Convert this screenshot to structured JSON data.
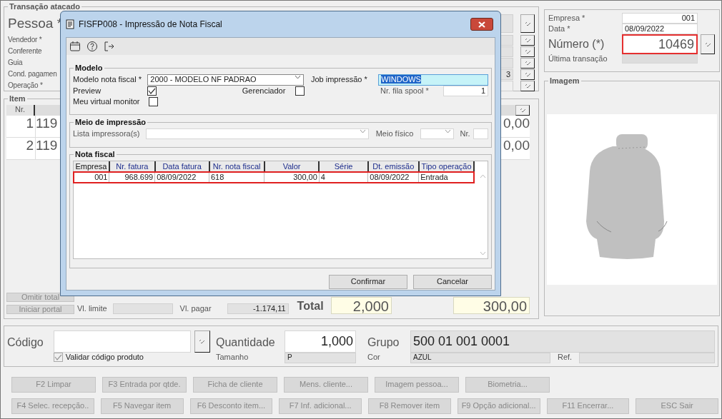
{
  "form": {
    "transaction": {
      "title": "Transação atacado",
      "person": {
        "label": "Pessoa *"
      },
      "fields": [
        {
          "label": "Vendedor *",
          "kind": "lookup"
        },
        {
          "label": "Conferente",
          "kind": "lookup"
        },
        {
          "label": "Guia",
          "kind": "lookup"
        },
        {
          "label": "Cond. pagamen",
          "kind": "lookup",
          "value": "3"
        },
        {
          "label": "Operação *",
          "kind": "dropdown"
        }
      ]
    },
    "items": {
      "title": "Item",
      "columns": [
        "Nr."
      ],
      "rows": [
        {
          "number": "1",
          "code": "119",
          "total": "0,00"
        },
        {
          "number": "2",
          "code": "119",
          "total": "0,00"
        }
      ]
    },
    "actions": [
      "Omitir total",
      "Iniciar portal"
    ],
    "limit_label": "Vl. limite",
    "pay": {
      "label": "Vl. pagar",
      "value": "-1.174,11"
    },
    "total": {
      "label": "Total",
      "quantity": "2,000",
      "amount": "300,00"
    }
  },
  "header": {
    "company": {
      "label": "Empresa *",
      "value": "001"
    },
    "date": {
      "label": "Data *",
      "value": "08/09/2022"
    },
    "number": {
      "label": "Número (*)",
      "value": "10469",
      "highlighted": true
    },
    "last_transaction": {
      "label": "Última transação"
    }
  },
  "image_panel": {
    "title": "Imagem"
  },
  "product": {
    "code_label": "Código",
    "validate": {
      "label": "Validar código produto",
      "checked": true,
      "disabled": true
    },
    "quantity": {
      "label": "Quantidade",
      "value": "1,000"
    },
    "size": {
      "label": "Tamanho",
      "value": "P"
    },
    "group": {
      "label": "Grupo",
      "value": "500 01 001 0001"
    },
    "color": {
      "label": "Cor",
      "value": "AZUL"
    },
    "ref_label": "Ref."
  },
  "function_keys": [
    [
      {
        "label": "F2 Limpar",
        "disabled": true
      },
      {
        "label": "F3 Entrada por qtde.",
        "disabled": true
      },
      {
        "label": "Ficha de cliente",
        "disabled": true
      },
      {
        "label": "Mens. cliente...",
        "disabled": true
      },
      {
        "label": "Imagem pessoa...",
        "disabled": true
      },
      {
        "label": "Biometria...",
        "disabled": true
      }
    ],
    [
      {
        "label": "F4 Selec. recepção..",
        "disabled": true
      },
      {
        "label": "F5 Navegar item",
        "disabled": true
      },
      {
        "label": "F6 Desconto item...",
        "disabled": true
      },
      {
        "label": "F7 Inf. adicional...",
        "disabled": true
      },
      {
        "label": "F8 Remover item",
        "disabled": true
      },
      {
        "label": "F9 Opção adicional...",
        "disabled": true
      },
      {
        "label": "F11 Encerrar...",
        "disabled": true
      },
      {
        "label": "ESC Sair",
        "disabled": true
      }
    ]
  ],
  "dialog": {
    "title": "FISFP008 - Impressão de Nota Fiscal",
    "model": {
      "title": "Modelo",
      "model_label": "Modelo nota fiscal *",
      "model_value": "2000 - MODELO NF PADRAO",
      "job_label": "Job impressão *",
      "job_value": "WINDOWS",
      "spool_label": "Nr. fila spool *",
      "spool_value": "1",
      "checks": [
        {
          "label": "Preview",
          "checked": true
        },
        {
          "label": "Gerenciador",
          "checked": false
        },
        {
          "label": "Meu virtual monitor",
          "checked": false
        }
      ]
    },
    "printing": {
      "title": "Meio de impressão",
      "printer_label": "Lista impressora(s)",
      "medium_label": "Meio físico",
      "nr_label": "Nr."
    },
    "invoices": {
      "title": "Nota fiscal",
      "columns": [
        {
          "label": "Empresa",
          "numeric": true
        },
        {
          "label": "Nr. fatura",
          "numeric": true
        },
        {
          "label": "Data fatura",
          "numeric": false
        },
        {
          "label": "Nr. nota fiscal",
          "numeric": false
        },
        {
          "label": "Valor",
          "numeric": true
        },
        {
          "label": "Série",
          "numeric": false
        },
        {
          "label": "Dt. emissão",
          "numeric": false
        },
        {
          "label": "Tipo operação",
          "numeric": false
        }
      ],
      "rows": [
        {
          "cells": [
            "001",
            "968.699",
            "08/09/2022",
            "618",
            "300,00",
            "4",
            "08/09/2022",
            "Entrada"
          ],
          "highlighted": true
        }
      ]
    },
    "buttons": [
      "Confirmar",
      "Cancelar"
    ]
  }
}
